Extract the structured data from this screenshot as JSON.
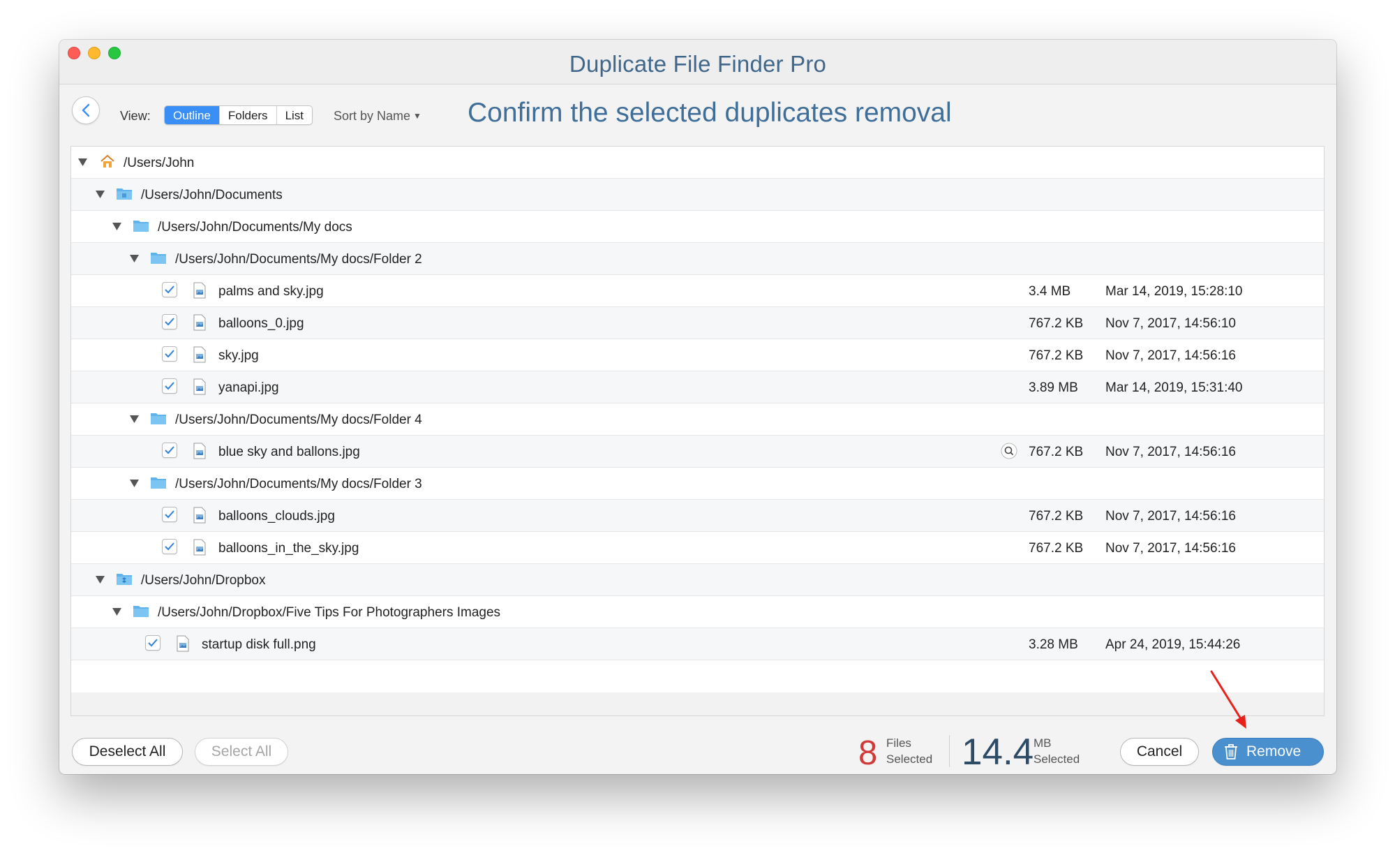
{
  "window": {
    "title": "Duplicate File Finder Pro"
  },
  "toolbar": {
    "view_label": "View:",
    "view_options": [
      "Outline",
      "Folders",
      "List"
    ],
    "sort_label": "Sort by Name",
    "heading": "Confirm the selected duplicates removal"
  },
  "tree": {
    "folders": {
      "root": "/Users/John",
      "documents": "/Users/John/Documents",
      "mydocs": "/Users/John/Documents/My docs",
      "folder2": "/Users/John/Documents/My docs/Folder 2",
      "folder4": "/Users/John/Documents/My docs/Folder 4",
      "folder3": "/Users/John/Documents/My docs/Folder 3",
      "dropbox": "/Users/John/Dropbox",
      "fivetips": "/Users/John/Dropbox/Five Tips For Photographers Images"
    },
    "files": [
      {
        "name": "palms and sky.jpg",
        "size": "3.4 MB",
        "date": "Mar 14, 2019, 15:28:10"
      },
      {
        "name": "balloons_0.jpg",
        "size": "767.2 KB",
        "date": "Nov 7, 2017, 14:56:10"
      },
      {
        "name": "sky.jpg",
        "size": "767.2 KB",
        "date": "Nov 7, 2017, 14:56:16"
      },
      {
        "name": "yanapi.jpg",
        "size": "3.89 MB",
        "date": "Mar 14, 2019, 15:31:40"
      },
      {
        "name": "blue sky and ballons.jpg",
        "size": "767.2 KB",
        "date": "Nov 7, 2017, 14:56:16"
      },
      {
        "name": "balloons_clouds.jpg",
        "size": "767.2 KB",
        "date": "Nov 7, 2017, 14:56:16"
      },
      {
        "name": "balloons_in_the_sky.jpg",
        "size": "767.2 KB",
        "date": "Nov 7, 2017, 14:56:16"
      },
      {
        "name": "startup disk full.png",
        "size": "3.28 MB",
        "date": "Apr 24, 2019, 15:44:26"
      }
    ]
  },
  "bottom": {
    "deselect_all": "Deselect All",
    "select_all": "Select All",
    "files_count": "8",
    "files_label_1": "Files",
    "files_label_2": "Selected",
    "size_value": "14.4",
    "size_unit": "MB",
    "size_label": "Selected",
    "cancel": "Cancel",
    "remove": "Remove"
  },
  "colors": {
    "accent": "#3a8ff7",
    "title": "#40678a",
    "remove_button": "#4a90cf",
    "files_count": "#d23a3a",
    "annotation_arrow": "#e8221b"
  },
  "icons": [
    "back-chevron-icon",
    "home-icon",
    "folder-icon",
    "dropbox-folder-icon",
    "disclosure-triangle-icon",
    "checkbox-checked-icon",
    "image-file-icon",
    "quicklook-magnifier-icon",
    "trash-icon"
  ]
}
